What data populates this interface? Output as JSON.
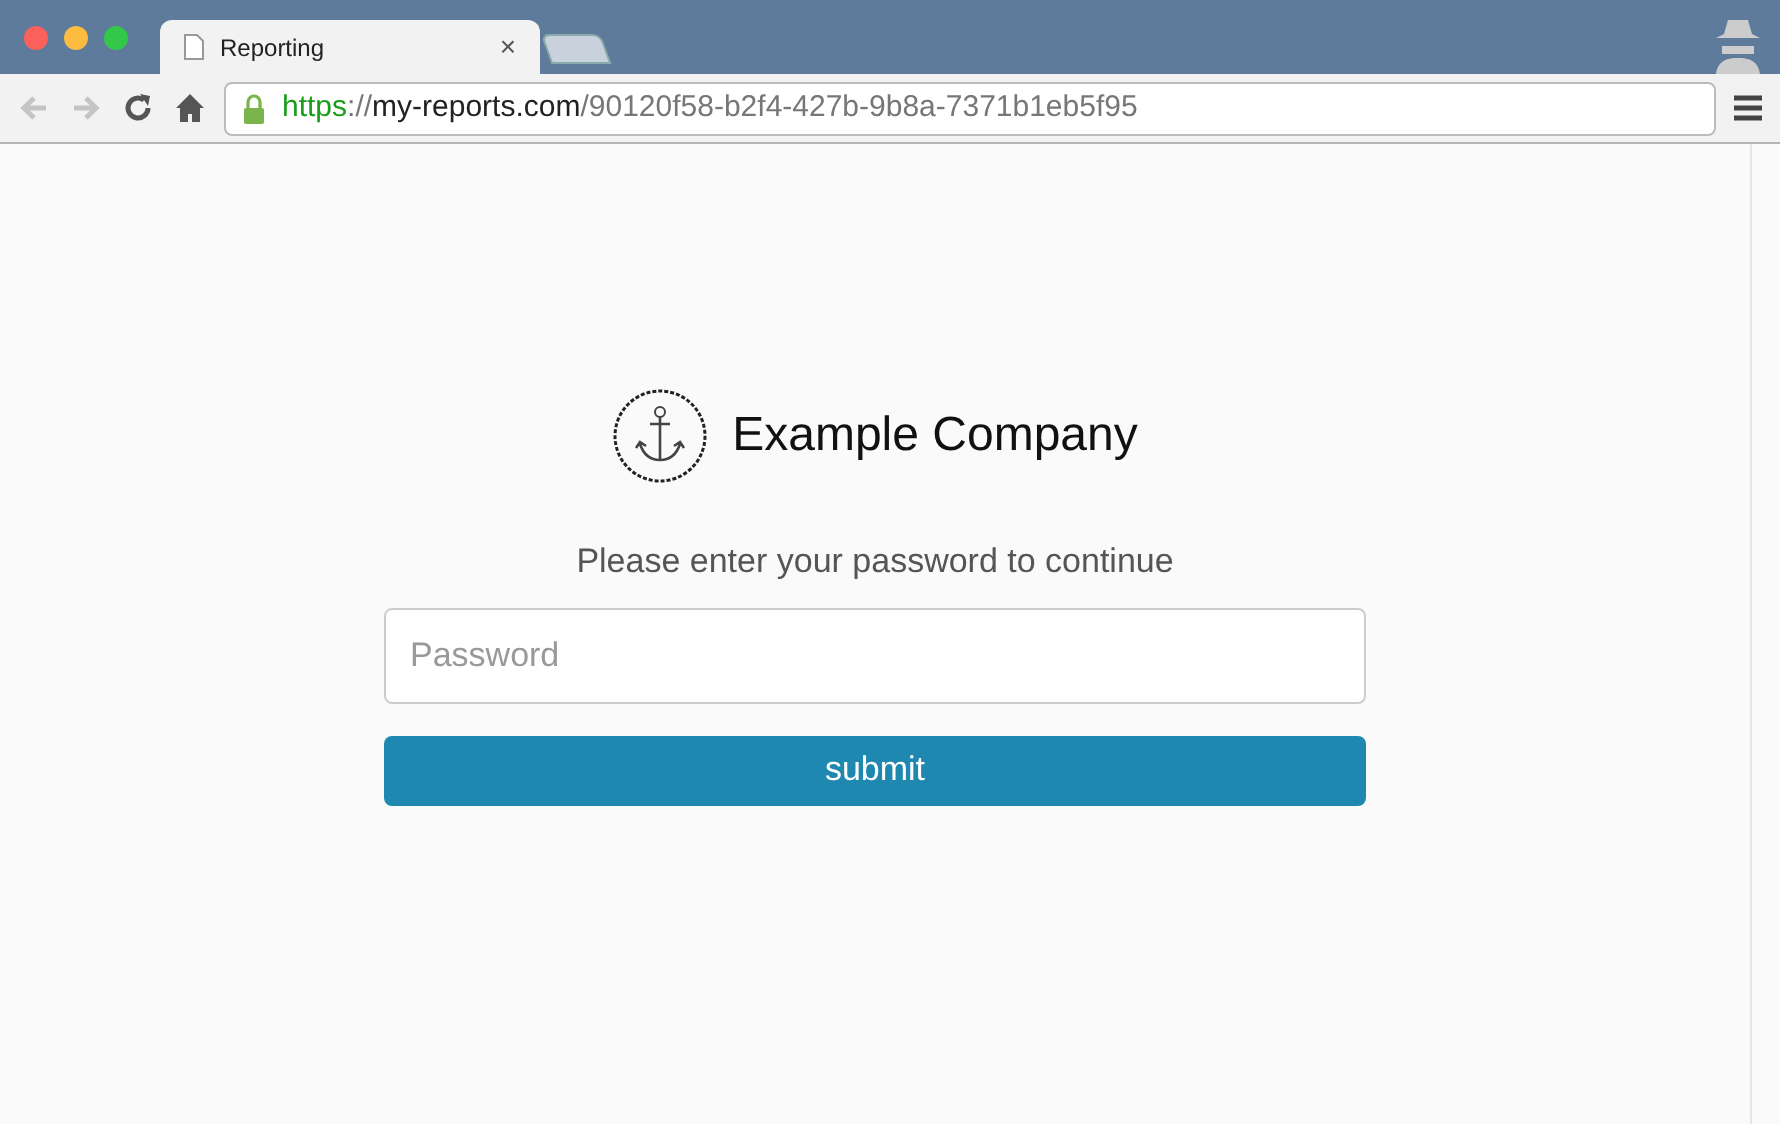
{
  "tabs": [
    {
      "title": "Reporting",
      "close": "×",
      "selected": true
    }
  ],
  "address_bar": {
    "scheme": "https",
    "separator": "://",
    "host": "my-reports.com",
    "path": "/90120f58-b2f4-427b-9b8a-7371b1eb5f95",
    "secure": true
  },
  "nav": {
    "back_disabled": true,
    "forward_disabled": true
  },
  "page": {
    "company": "Example Company",
    "prompt": "Please enter your password to continue",
    "password": {
      "placeholder": "Password"
    },
    "submit": "submit"
  }
}
